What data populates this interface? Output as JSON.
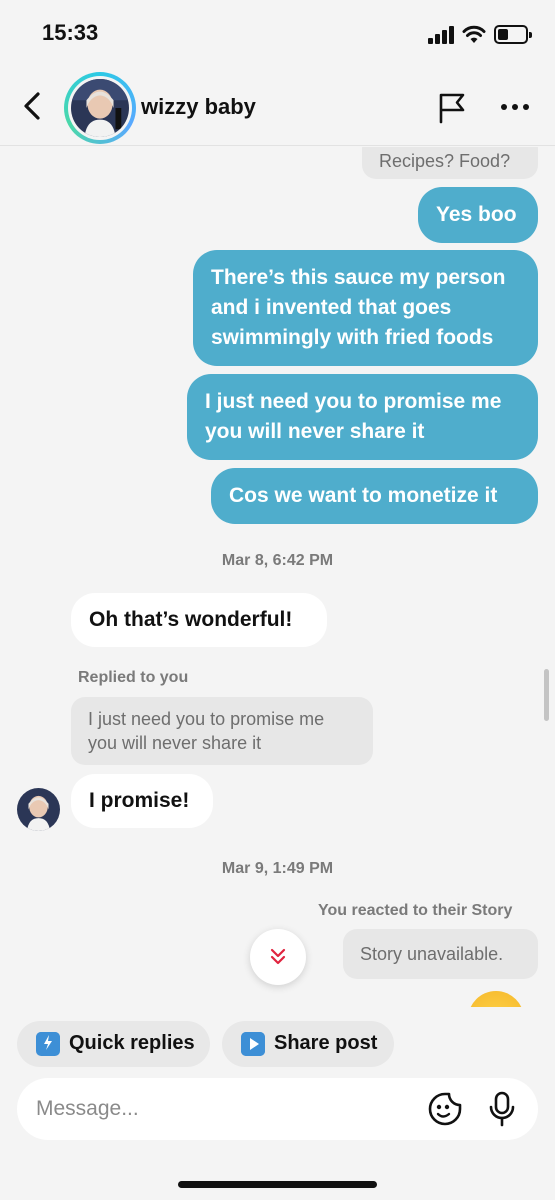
{
  "status_bar": {
    "time": "15:33"
  },
  "header": {
    "contact_name": "wizzy baby"
  },
  "messages": {
    "partial_top": "Recipes? Food?",
    "out_1": "Yes boo",
    "out_2": "There’s this sauce my person and i invented that goes swimmingly with fried foods",
    "out_3": "I just need you to promise me you will never share it",
    "out_4": "Cos we want to monetize it",
    "timestamp_1": "Mar 8, 6:42 PM",
    "in_1": "Oh that’s wonderful!",
    "replied_label": "Replied to you",
    "replied_quote": "I just need you to promise me you will never share it",
    "in_2": "I promise!",
    "timestamp_2": "Mar 9, 1:49 PM",
    "story_reaction_label": "You reacted to their Story",
    "story_unavailable": "Story unavailable."
  },
  "quick_actions": {
    "quick_replies": "Quick replies",
    "share_post": "Share post"
  },
  "composer": {
    "placeholder": "Message..."
  },
  "colors": {
    "outgoing_bubble": "#4fadcc",
    "background": "#f4f4f4"
  },
  "icons": [
    "back-chevron-icon",
    "flag-icon",
    "more-dots-icon",
    "double-chevron-down-icon",
    "quick-reply-icon",
    "share-play-icon",
    "sticker-icon",
    "microphone-icon"
  ]
}
